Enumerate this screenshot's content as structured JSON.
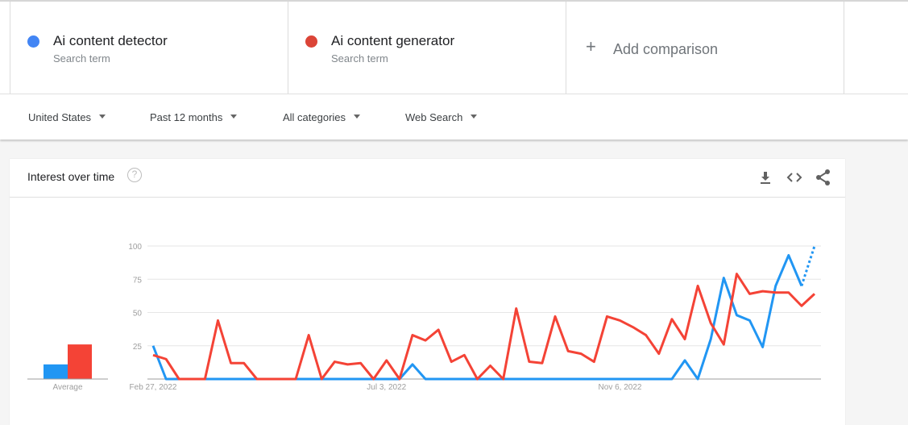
{
  "terms": [
    {
      "name": "Ai content detector",
      "subtitle": "Search term",
      "color": "#4285f4"
    },
    {
      "name": "Ai content generator",
      "subtitle": "Search term",
      "color": "#db4437"
    }
  ],
  "add_comparison": {
    "icon": "plus-icon",
    "label": "Add comparison"
  },
  "filters": [
    {
      "label": "United States"
    },
    {
      "label": "Past 12 months"
    },
    {
      "label": "All categories"
    },
    {
      "label": "Web Search"
    }
  ],
  "card": {
    "title": "Interest over time",
    "help_icon": "?",
    "actions": [
      "download-icon",
      "embed-icon",
      "share-icon"
    ]
  },
  "chart_data": {
    "type": "line",
    "title": "Interest over time",
    "xlabel": "",
    "ylabel": "",
    "ylim": [
      0,
      100
    ],
    "y_ticks": [
      100,
      75,
      50,
      25
    ],
    "grid": true,
    "x_tick_labels": [
      {
        "index": 0,
        "label": "Feb 27, 2022"
      },
      {
        "index": 18,
        "label": "Jul 3, 2022"
      },
      {
        "index": 36,
        "label": "Nov 6, 2022"
      }
    ],
    "num_points": 52,
    "partial_last_point": true,
    "series": [
      {
        "name": "Ai content detector",
        "color": "#2196f3",
        "values": [
          25,
          0,
          0,
          0,
          0,
          0,
          0,
          0,
          0,
          0,
          0,
          0,
          0,
          0,
          0,
          0,
          0,
          0,
          0,
          0,
          11,
          0,
          0,
          0,
          0,
          0,
          0,
          0,
          0,
          0,
          0,
          0,
          0,
          0,
          0,
          0,
          0,
          0,
          0,
          0,
          0,
          14,
          0,
          30,
          76,
          48,
          44,
          24,
          70,
          93,
          70,
          100
        ]
      },
      {
        "name": "Ai content generator",
        "color": "#f44336",
        "values": [
          18,
          15,
          0,
          0,
          0,
          44,
          12,
          12,
          0,
          0,
          0,
          0,
          33,
          0,
          13,
          11,
          12,
          0,
          14,
          0,
          33,
          29,
          37,
          13,
          18,
          0,
          10,
          0,
          53,
          13,
          12,
          47,
          21,
          19,
          13,
          47,
          44,
          39,
          33,
          19,
          45,
          30,
          70,
          42,
          26,
          79,
          64,
          66,
          65,
          65,
          55,
          64
        ]
      }
    ],
    "average": {
      "label": "Average",
      "values": [
        {
          "name": "Ai content detector",
          "value": 11
        },
        {
          "name": "Ai content generator",
          "value": 26
        }
      ]
    }
  }
}
